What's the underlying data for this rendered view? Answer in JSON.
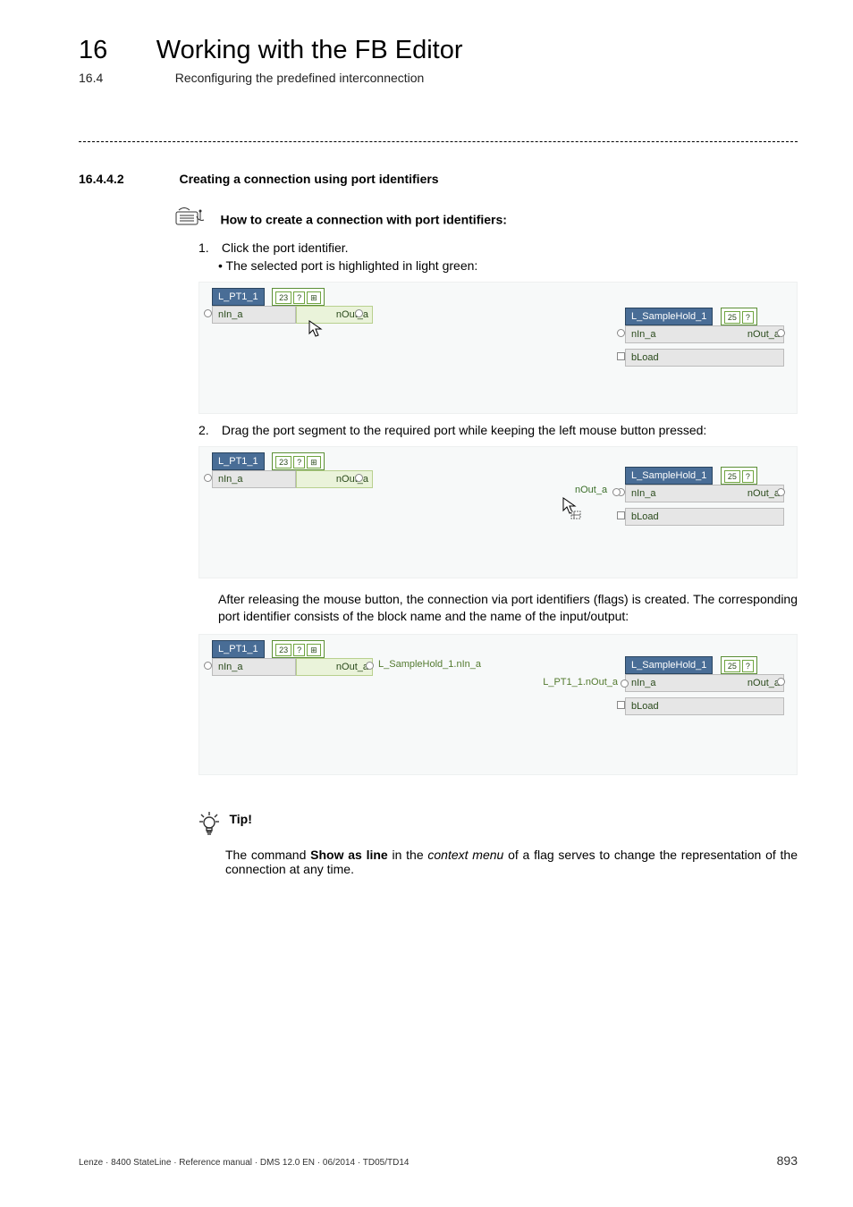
{
  "header": {
    "chapter_number": "16",
    "chapter_title": "Working with the FB Editor",
    "section_number": "16.4",
    "section_title": "Reconfiguring the predefined interconnection"
  },
  "section": {
    "number": "16.4.4.2",
    "heading": "Creating a connection using port identifiers"
  },
  "howto": {
    "label": "How to create a connection with port identifiers:"
  },
  "steps": {
    "s1_num": "1.",
    "s1_text": "Click the port identifier.",
    "s1_bullet": "The selected port is highlighted in light green:",
    "s2_num": "2.",
    "s2_text": "Drag the port segment to the required port while keeping the left mouse button pressed:",
    "after_text": "After releasing the mouse button, the connection via port identifiers (flags) is created. The corresponding port identifier consists of the block name and the name of the input/output:"
  },
  "fig_labels": {
    "block_a_title": "L_PT1_1",
    "block_a_in": "nIn_a",
    "block_a_out": "nOut_a",
    "badge_a1": "23",
    "badge_q": "?",
    "badge_grid": "⊞",
    "block_b_title": "L_SampleHold_1",
    "block_b_in1": "nIn_a",
    "block_b_in2": "bLoad",
    "block_b_out": "nOut_a",
    "badge_b1": "25",
    "drag_label": "nOut_a",
    "flag_left": "L_SampleHold_1.nIn_a",
    "flag_right": "L_PT1_1.nOut_a"
  },
  "tip": {
    "heading": "Tip!",
    "body_pre": "The command ",
    "body_bold": "Show as line",
    "body_mid": " in the ",
    "body_italic": "context menu",
    "body_post": " of a flag serves to change the representation of the connection at any time."
  },
  "footer": {
    "text": "Lenze · 8400 StateLine · Reference manual · DMS 12.0 EN · 06/2014 · TD05/TD14",
    "page": "893"
  }
}
